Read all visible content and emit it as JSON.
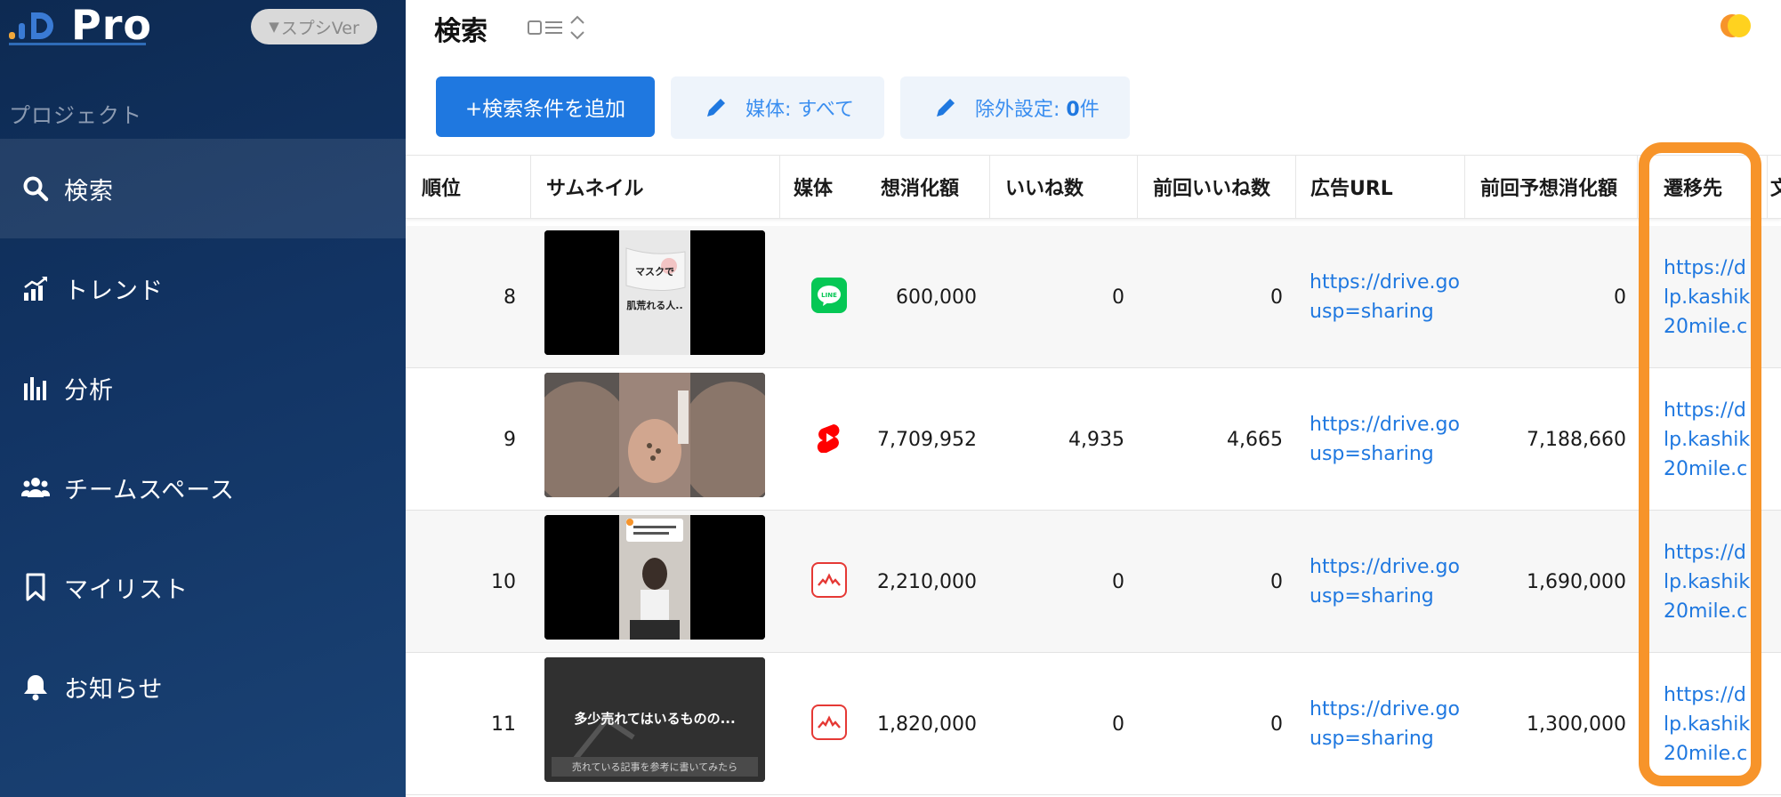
{
  "brand": {
    "name": "Pro",
    "version_badge": "スプシVer"
  },
  "sidebar": {
    "section_label": "プロジェクト",
    "items": [
      {
        "label": "検索",
        "icon": "search-icon",
        "active": true
      },
      {
        "label": "トレンド",
        "icon": "trend-chart-icon",
        "active": false
      },
      {
        "label": "分析",
        "icon": "bar-chart-icon",
        "active": false
      },
      {
        "label": "チームスペース",
        "icon": "team-icon",
        "active": false
      },
      {
        "label": "マイリスト",
        "icon": "bookmark-icon",
        "active": false
      },
      {
        "label": "お知らせ",
        "icon": "bell-icon",
        "active": false
      }
    ]
  },
  "header": {
    "title": "検索"
  },
  "toolbar": {
    "add_condition": "+検索条件を追加",
    "media_filter_label": "媒体: ",
    "media_filter_value": "すべて",
    "exclude_label": "除外設定: ",
    "exclude_count": "0",
    "exclude_unit": "件"
  },
  "table": {
    "columns": [
      "順位",
      "サムネイル",
      "媒体",
      "想消化額",
      "いいね数",
      "前回いいね数",
      "広告URL",
      "前回予想消化額",
      "遷移先",
      "文"
    ],
    "rows": [
      {
        "rank": "8",
        "thumb_text": "マスクで\n肌荒れる人..",
        "media": "LINE",
        "spend": "600,000",
        "likes": "0",
        "prev_likes": "0",
        "ad_url_1": "https://drive.go",
        "ad_url_2": "usp=sharing",
        "prev_spend": "0",
        "dest_1": "https://d",
        "dest_2": "lp.kashik",
        "dest_3": "20mile.c"
      },
      {
        "rank": "9",
        "thumb_text": "",
        "media": "YouTube Shorts",
        "spend": "7,709,952",
        "likes": "4,935",
        "prev_likes": "4,665",
        "ad_url_1": "https://drive.go",
        "ad_url_2": "usp=sharing",
        "prev_spend": "7,188,660",
        "dest_1": "https://d",
        "dest_2": "lp.kashik",
        "dest_3": "20mile.c"
      },
      {
        "rank": "10",
        "thumb_text": "",
        "media": "Logly",
        "spend": "2,210,000",
        "likes": "0",
        "prev_likes": "0",
        "ad_url_1": "https://drive.go",
        "ad_url_2": "usp=sharing",
        "prev_spend": "1,690,000",
        "dest_1": "https://d",
        "dest_2": "lp.kashik",
        "dest_3": "20mile.c"
      },
      {
        "rank": "11",
        "thumb_text": "多少売れてはいるものの...",
        "thumb_sub": "売れている記事を参考に書いてみたら",
        "media": "Logly",
        "spend": "1,820,000",
        "likes": "0",
        "prev_likes": "0",
        "ad_url_1": "https://drive.go",
        "ad_url_2": "usp=sharing",
        "prev_spend": "1,300,000",
        "dest_1": "https://d",
        "dest_2": "lp.kashik",
        "dest_3": "20mile.c"
      }
    ]
  },
  "colors": {
    "sidebar_bg": "#123464",
    "primary": "#1f78e0",
    "link": "#1f78e0",
    "highlight": "#f7942a",
    "line_green": "#06c755",
    "shorts_red": "#ff0000"
  }
}
